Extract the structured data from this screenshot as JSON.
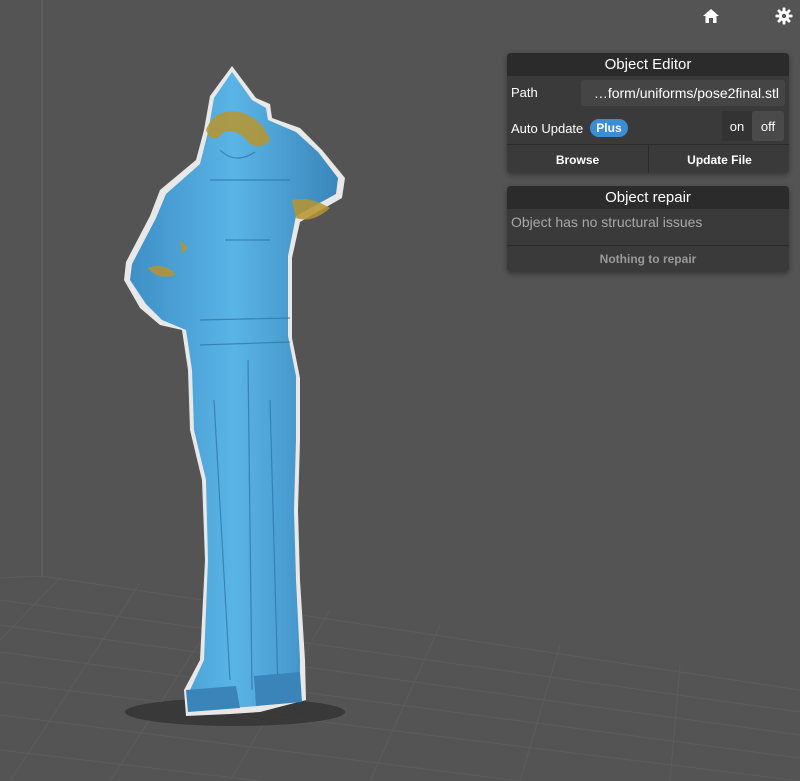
{
  "toolbar": {
    "home_icon": "home-icon",
    "settings_icon": "gear-icon"
  },
  "object_editor": {
    "title": "Object Editor",
    "path_label": "Path",
    "path_value": "…form/uniforms/pose2final.stl",
    "auto_update_label": "Auto Update",
    "plus_badge": "Plus",
    "toggle_on": "on",
    "toggle_off": "off",
    "toggle_selected": "off",
    "browse_label": "Browse",
    "update_file_label": "Update File"
  },
  "object_repair": {
    "title": "Object repair",
    "status": "Object has no structural issues",
    "action_label": "Nothing to repair"
  },
  "colors": {
    "model_blue": "#4aa3d8",
    "background": "#545454",
    "accent": "#3b8ed6"
  }
}
